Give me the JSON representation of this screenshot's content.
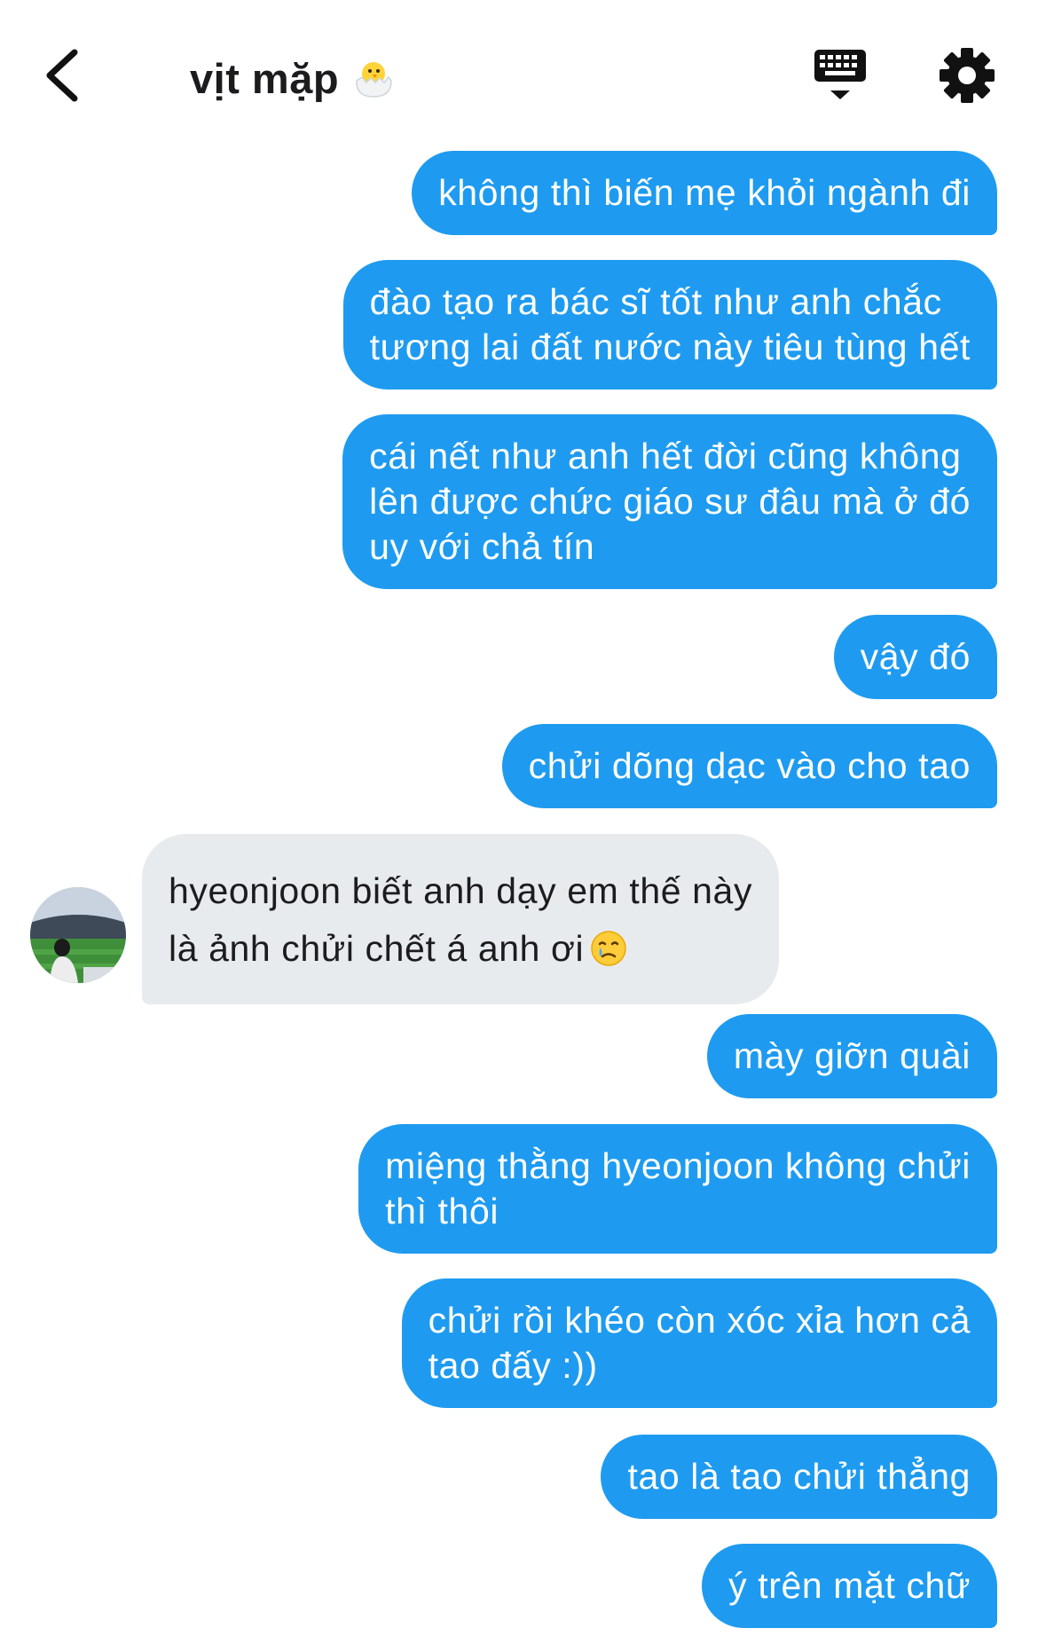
{
  "header": {
    "back_icon": "chevron-left-icon",
    "title": "vịt mặp",
    "title_icon": "hatching-chick-icon",
    "keyboard_icon": "keyboard-icon",
    "settings_icon": "gear-icon"
  },
  "colors": {
    "sent_bubble": "#1e9bf0",
    "received_bubble": "#e8ebee",
    "sent_text": "#ffffff",
    "received_text": "#1c1c1e"
  },
  "messages": [
    {
      "sender": "me",
      "lines": [
        "không thì biến mẹ khỏi ngành đi"
      ]
    },
    {
      "sender": "me",
      "lines": [
        "đào tạo ra bác sĩ tốt như anh chắc",
        "tương lai đất nước này tiêu tùng hết"
      ]
    },
    {
      "sender": "me",
      "lines": [
        "cái nết như anh hết đời cũng không",
        "lên được chức giáo sư đâu mà ở đó",
        "uy với chả tín"
      ]
    },
    {
      "sender": "me",
      "lines": [
        "vậy đó"
      ]
    },
    {
      "sender": "me",
      "lines": [
        "chửi dõng dạc vào cho tao"
      ]
    },
    {
      "sender": "them",
      "lines": [
        "hyeonjoon biết anh dạy em thế này",
        "là ảnh chửi chết á anh ơi"
      ],
      "emoji": "crying-face-icon"
    },
    {
      "sender": "me",
      "lines": [
        "mày giỡn quài"
      ]
    },
    {
      "sender": "me",
      "lines": [
        "miệng thằng hyeonjoon không chửi",
        "thì thôi"
      ]
    },
    {
      "sender": "me",
      "lines": [
        "chửi rồi khéo còn xóc xỉa hơn cả",
        "tao đấy :))"
      ]
    },
    {
      "sender": "me",
      "lines": [
        "tao là tao chửi thẳng"
      ]
    },
    {
      "sender": "me",
      "lines": [
        "ý trên mặt chữ"
      ]
    }
  ]
}
